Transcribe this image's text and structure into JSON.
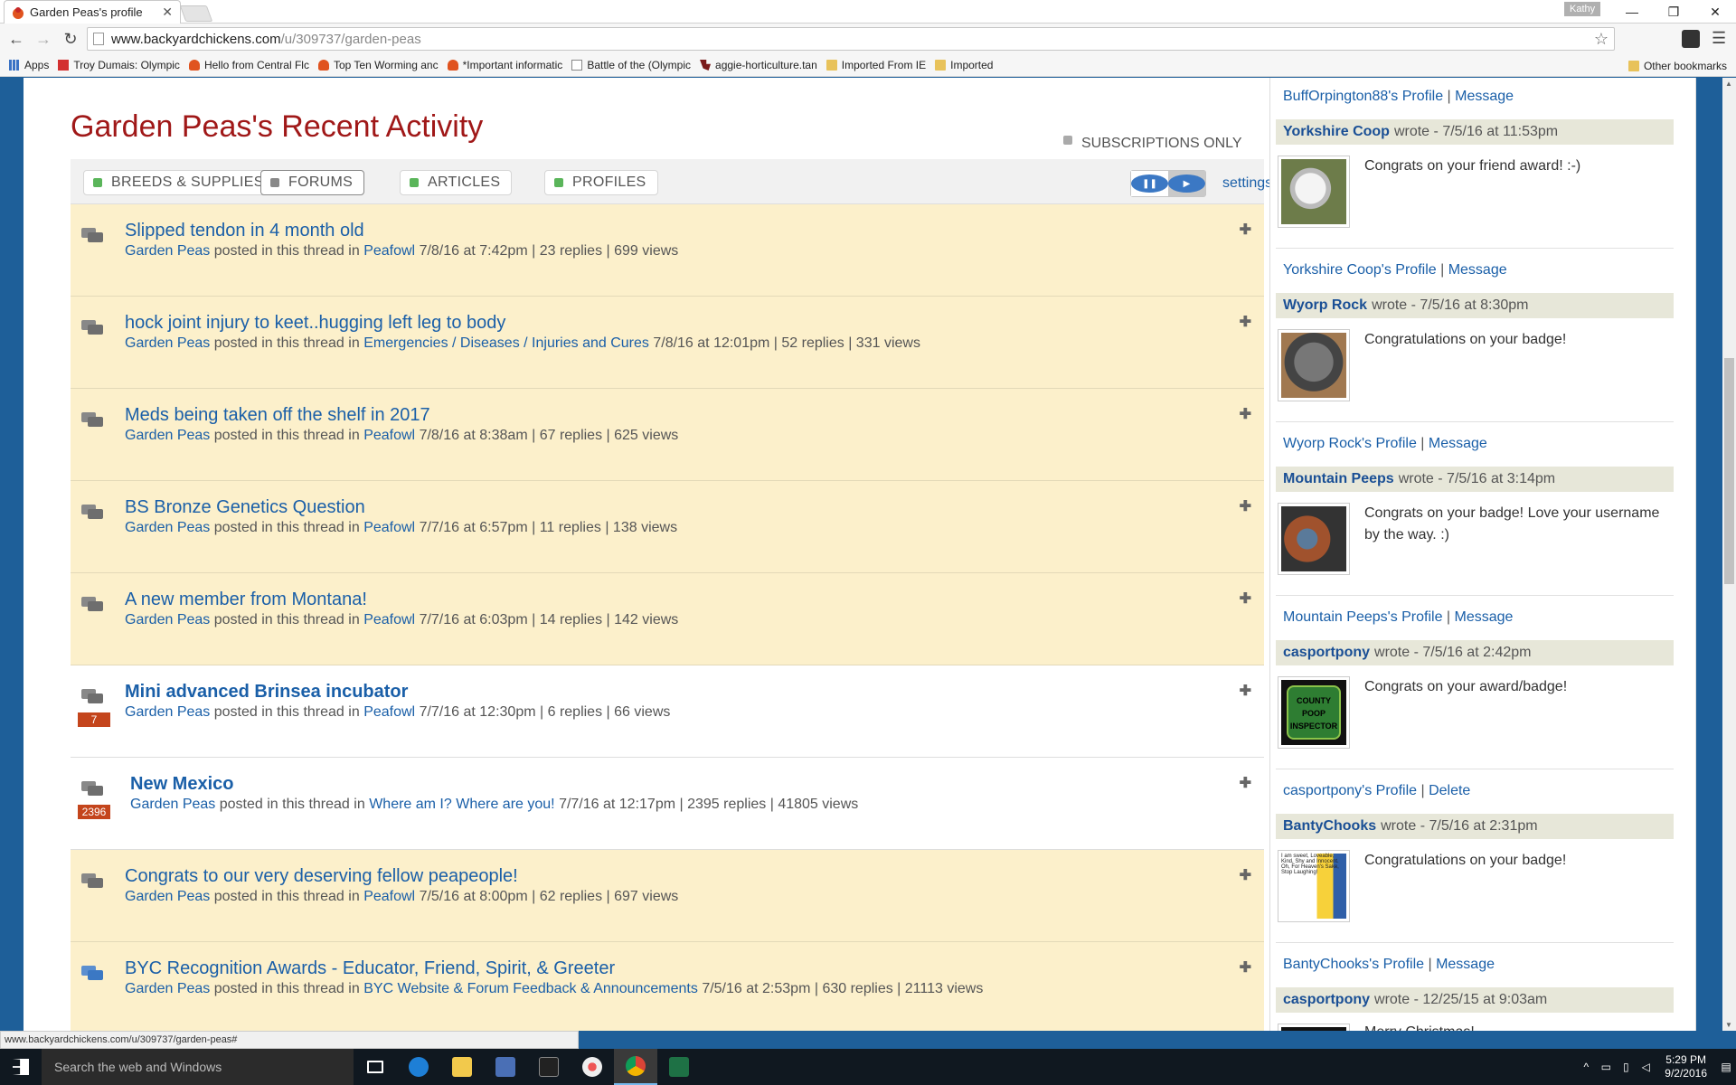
{
  "browser": {
    "tab_title": "Garden Peas's profile",
    "profile_name": "Kathy",
    "url_host": "www.backyardchickens.com",
    "url_path": "/u/309737/garden-peas",
    "bookmarks": [
      {
        "label": "Apps",
        "icon": "apps-grid-icon"
      },
      {
        "label": "Troy Dumais: Olympic",
        "icon": "flipboard-icon"
      },
      {
        "label": "Hello from Central Flc",
        "icon": "chicken-icon"
      },
      {
        "label": "Top Ten Worming anc",
        "icon": "chicken-icon"
      },
      {
        "label": "*Important informatic",
        "icon": "chicken-icon"
      },
      {
        "label": "Battle of the (Olympic",
        "icon": "document-icon"
      },
      {
        "label": "aggie-horticulture.tan",
        "icon": "texas-icon"
      },
      {
        "label": "Imported From IE",
        "icon": "folder-icon"
      },
      {
        "label": "Imported",
        "icon": "folder-icon"
      }
    ],
    "other_bookmarks": "Other bookmarks",
    "status_url": "www.backyardchickens.com/u/309737/garden-peas#"
  },
  "activity": {
    "title": "Garden Peas's Recent Activity",
    "subscriptions_only": "SUBSCRIPTIONS ONLY",
    "filters": [
      "BREEDS & SUPPLIES",
      "FORUMS",
      "ARTICLES",
      "PROFILES"
    ],
    "settings": "settings",
    "posted_text": "posted in this thread in",
    "items": [
      {
        "title": "Slipped tendon in 4 month old",
        "user": "Garden Peas",
        "forum": "Peafowl",
        "stats": "7/8/16 at 7:42pm | 23 replies | 699 views",
        "badge": ""
      },
      {
        "title": "hock joint injury to keet..hugging left leg to body",
        "user": "Garden Peas",
        "forum": "Emergencies / Diseases / Injuries and Cures",
        "stats": "7/8/16 at 12:01pm | 52 replies | 331 views",
        "badge": ""
      },
      {
        "title": "Meds being taken off the shelf in 2017",
        "user": "Garden Peas",
        "forum": "Peafowl",
        "stats": "7/8/16 at 8:38am | 67 replies | 625 views",
        "badge": ""
      },
      {
        "title": "BS Bronze Genetics Question",
        "user": "Garden Peas",
        "forum": "Peafowl",
        "stats": "7/7/16 at 6:57pm | 11 replies | 138 views",
        "badge": ""
      },
      {
        "title": "A new member from Montana!",
        "user": "Garden Peas",
        "forum": "Peafowl",
        "stats": "7/7/16 at 6:03pm | 14 replies | 142 views",
        "badge": ""
      },
      {
        "title": "Mini advanced Brinsea incubator",
        "user": "Garden Peas",
        "forum": "Peafowl",
        "stats": "7/7/16 at 12:30pm | 6 replies | 66 views",
        "badge": "7"
      },
      {
        "title": "New Mexico",
        "user": "Garden Peas",
        "forum": "Where am I? Where are you!",
        "stats": "7/7/16 at 12:17pm | 2395 replies | 41805 views",
        "badge": "2396"
      },
      {
        "title": "Congrats to our very deserving fellow peapeople!",
        "user": "Garden Peas",
        "forum": "Peafowl",
        "stats": "7/5/16 at 8:00pm | 62 replies | 697 views",
        "badge": ""
      },
      {
        "title": "BYC Recognition Awards - Educator, Friend, Spirit, & Greeter",
        "user": "Garden Peas",
        "forum": "BYC Website & Forum Feedback & Announcements",
        "stats": "7/5/16 at 2:53pm | 630 replies | 21113 views",
        "badge": ""
      }
    ]
  },
  "sidebar": {
    "top_profile_link": "BuffOrpington88's Profile",
    "top_message_link": "Message",
    "wrote": "wrote -",
    "comments": [
      {
        "author": "Yorkshire Coop",
        "date": "7/5/16 at 11:53pm",
        "message": "Congrats on your friend award! :-)",
        "profile_link": "Yorkshire Coop's Profile",
        "action": "Message"
      },
      {
        "author": "Wyorp Rock",
        "date": "7/5/16 at 8:30pm",
        "message": "Congratulations on your badge!",
        "profile_link": "Wyorp Rock's Profile",
        "action": "Message"
      },
      {
        "author": "Mountain Peeps",
        "date": "7/5/16 at 3:14pm",
        "message": "Congrats on your badge! Love your username by the way. :)",
        "profile_link": "Mountain Peeps's Profile",
        "action": "Message"
      },
      {
        "author": "casportpony",
        "date": "7/5/16 at 2:42pm",
        "message": "Congrats on your award/badge!",
        "profile_link": "casportpony's Profile",
        "action": "Delete"
      },
      {
        "author": "BantyChooks",
        "date": "7/5/16 at 2:31pm",
        "message": "Congratulations on your badge!",
        "profile_link": "BantyChooks's Profile",
        "action": "Message"
      },
      {
        "author": "casportpony",
        "date": "12/25/15 at 9:03am",
        "message": "Merry Christmas!",
        "profile_link": "",
        "action": ""
      }
    ],
    "badge_avatar_text": "COUNTY POOP INSPECTOR",
    "minion_avatar_text": "I am sweet, Loveable, Kind, Shy and Innocent. Oh, For Heaven's Sake, Stop Laughing!"
  },
  "taskbar": {
    "search_placeholder": "Search the web and Windows",
    "time": "5:29 PM",
    "date": "9/2/2016"
  },
  "colors": {
    "title_red": "#a01818",
    "link_blue": "#1a5fa8",
    "yellow_row": "#fcf0cb",
    "page_blue": "#1e5f99"
  }
}
